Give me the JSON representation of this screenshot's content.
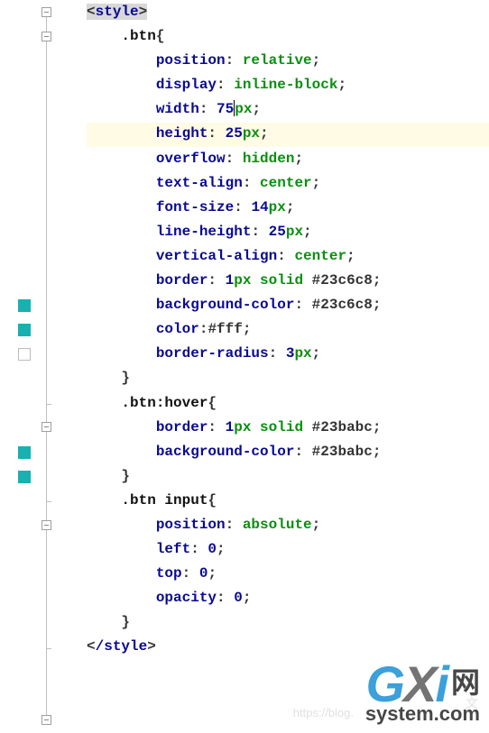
{
  "tag_open": "style",
  "tag_close": "/style",
  "selectors": {
    "btn": ".btn",
    "btn_hover": ".btn:hover",
    "btn_input": ".btn input"
  },
  "decl": {
    "position_relative": {
      "prop": "position",
      "val": "relative"
    },
    "display_inline_block": {
      "prop": "display",
      "val": "inline-block"
    },
    "width_75": {
      "prop": "width",
      "num": "75",
      "unit": "px"
    },
    "height_25": {
      "prop": "height",
      "num": "25",
      "unit": "px"
    },
    "overflow_hidden": {
      "prop": "overflow",
      "val": "hidden"
    },
    "text_align_center": {
      "prop": "text-align",
      "val": "center"
    },
    "font_size_14": {
      "prop": "font-size",
      "num": "14",
      "unit": "px"
    },
    "line_height_25": {
      "prop": "line-height",
      "num": "25",
      "unit": "px"
    },
    "vertical_align_center": {
      "prop": "vertical-align",
      "val": "center"
    },
    "border1": {
      "prop": "border",
      "num": "1",
      "unit": "px",
      "kw": "solid",
      "hex": "#23c6c8"
    },
    "bg1": {
      "prop": "background-color",
      "hex": "#23c6c8"
    },
    "color_fff": {
      "prop": "color",
      "hex": "#fff"
    },
    "border_radius_3": {
      "prop": "border-radius",
      "num": "3",
      "unit": "px"
    },
    "border2": {
      "prop": "border",
      "num": "1",
      "unit": "px",
      "kw": "solid",
      "hex": "#23babc"
    },
    "bg2": {
      "prop": "background-color",
      "hex": "#23babc"
    },
    "position_absolute": {
      "prop": "position",
      "val": "absolute"
    },
    "left_0": {
      "prop": "left",
      "num": "0"
    },
    "top_0": {
      "prop": "top",
      "num": "0"
    },
    "opacity_0": {
      "prop": "opacity",
      "num": "0"
    }
  },
  "brace_open": "{",
  "brace_close": "}",
  "watermark": {
    "brand_g": "G",
    "brand_x": "X",
    "brand_i": "i",
    "brand_cn": "网",
    "sub": "system.com",
    "faded_cn": "文",
    "faded_url": "https://blog."
  },
  "colors": {
    "highlight_bg": "#fffbe5",
    "change_marker": "#18b1b0"
  },
  "chart_data": null
}
